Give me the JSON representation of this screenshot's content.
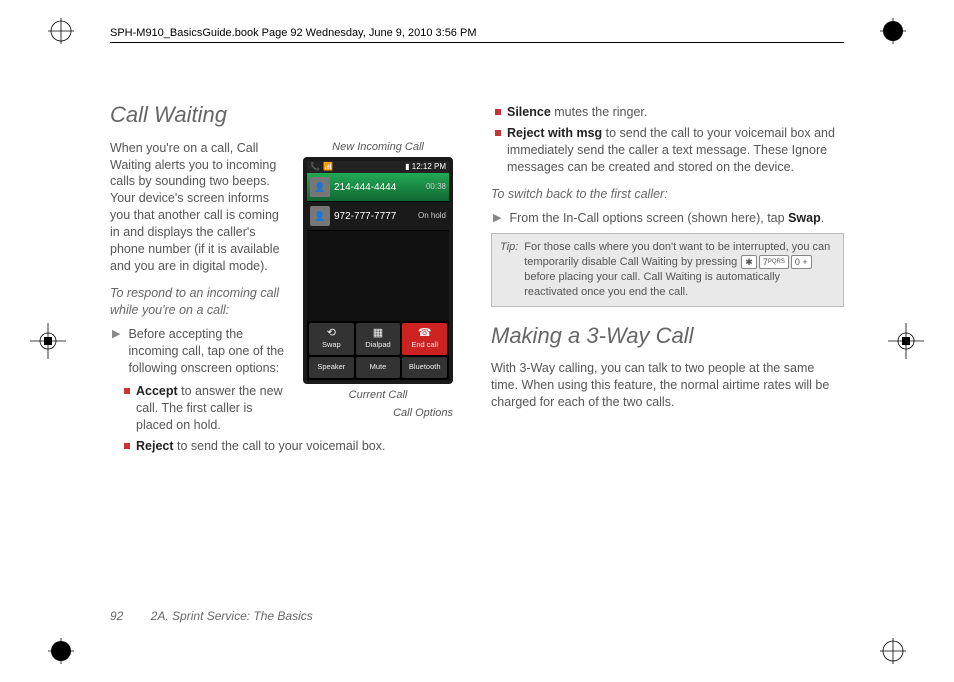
{
  "header": "SPH-M910_BasicsGuide.book  Page 92  Wednesday, June 9, 2010  3:56 PM",
  "footer": {
    "page": "92",
    "section": "2A. Sprint Service: The Basics"
  },
  "left": {
    "heading": "Call Waiting",
    "intro": "When you're on a call, Call Waiting alerts you to incoming calls by sounding two beeps. Your device's screen informs you that another call is coming in and displays the caller's phone number (if it is available and you are in digital mode).",
    "respond_leadin": "To respond to an incoming call while you're on a call:",
    "before_accept": "Before accepting the incoming call, tap one of the following onscreen options:",
    "opt_accept_term": "Accept",
    "opt_accept_rest": " to answer the new call. The first caller is placed on hold.",
    "opt_reject_term": "Reject",
    "opt_reject_rest": " to send the call to your voicemail box."
  },
  "figure": {
    "top_label": "New Incoming Call",
    "bottom_left": "Current Call",
    "bottom_right": "Call Options",
    "status_time": "12:12 PM",
    "row1_num": "214-444-4444",
    "row1_meta": "00:38",
    "row2_num": "972-777-7777",
    "row2_meta": "On hold",
    "btns": {
      "swap": "Swap",
      "dialpad": "Dialpad",
      "endcall": "End call",
      "speaker": "Speaker",
      "mute": "Mute",
      "bluetooth": "Bluetooth"
    }
  },
  "right": {
    "opt_silence_term": "Silence",
    "opt_silence_rest": " mutes the ringer.",
    "opt_rwm_term": "Reject with msg",
    "opt_rwm_rest": " to send the call to your voicemail box and immediately send the caller a text message. These Ignore messages can be created and stored on the device.",
    "switch_leadin": "To switch back to the first caller:",
    "switch_step_pre": "From the In-Call options screen (shown here), tap ",
    "switch_step_term": "Swap",
    "switch_step_post": ".",
    "tip_label": "Tip:",
    "tip_pre": "For those calls where you don't want to be interrupted, you can temporarily disable Call Waiting by pressing ",
    "tip_post": " before placing your call. Call Waiting is automatically reactivated once you end the call.",
    "key_star": "✱",
    "key_7": "7",
    "key_7_letters": "PQRS",
    "key_0": "0 +",
    "heading2": "Making a 3-Way Call",
    "threeway": "With 3-Way calling, you can talk to two people at the same time. When using this feature, the normal airtime rates will be charged for each of the two calls."
  }
}
